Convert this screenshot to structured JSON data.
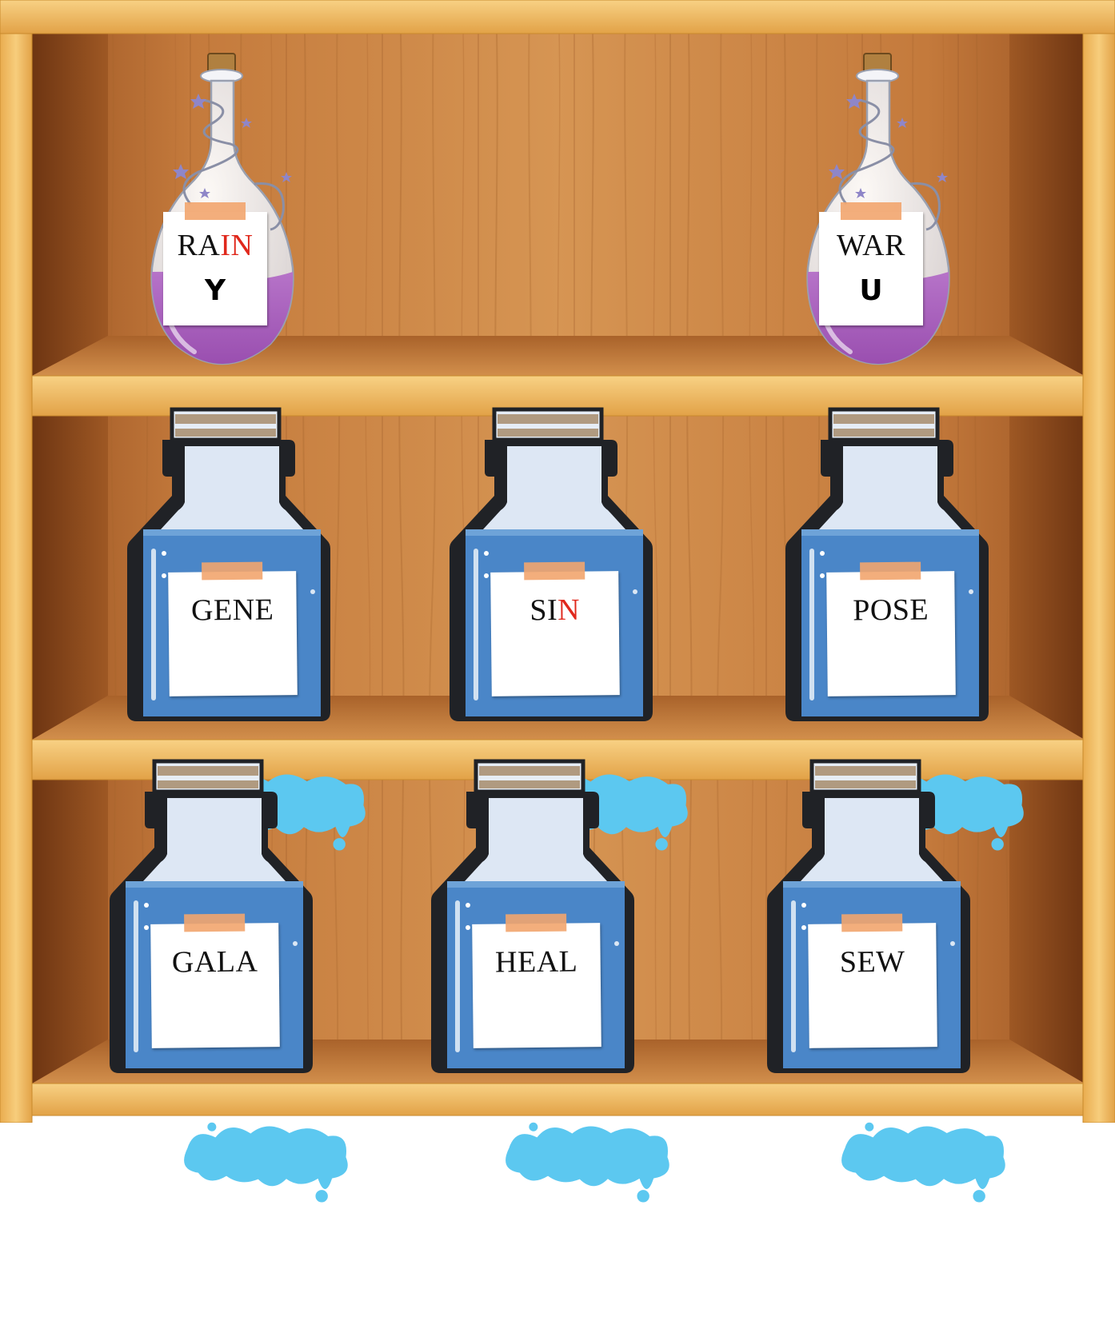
{
  "theme": {
    "frame": "#f3c06a",
    "frame_edge": "#c98a2c",
    "wood_dark": "#8a4a1f",
    "wood_mid": "#c07a3e",
    "wood_light": "#d99a5a",
    "shelf_top": "#c8843f",
    "label_tape": "#f2a56e",
    "accent_red": "#e0281c",
    "round_potion_liquid": "#9a4fb0",
    "square_potion_liquid": "#4a86c8",
    "splash": "#5cc8f0"
  },
  "shelves": [
    {
      "name": "top",
      "potions": [
        {
          "kind": "round",
          "prefix": "RA",
          "highlight": "IN",
          "suffix": "",
          "answer": "Y",
          "empty": false
        },
        {
          "kind": "round",
          "prefix": "WAR",
          "highlight": "",
          "suffix": "",
          "answer": "U",
          "empty": false
        }
      ]
    },
    {
      "name": "middle",
      "potions": [
        {
          "kind": "square",
          "prefix": "GENE",
          "highlight": "",
          "suffix": "",
          "answer": "",
          "empty": true
        },
        {
          "kind": "square",
          "prefix": "SI",
          "highlight": "N",
          "suffix": "",
          "answer": "",
          "empty": true
        },
        {
          "kind": "square",
          "prefix": "POSE",
          "highlight": "",
          "suffix": "",
          "answer": "",
          "empty": true
        }
      ]
    },
    {
      "name": "bottom",
      "potions": [
        {
          "kind": "square",
          "prefix": "GALA",
          "highlight": "",
          "suffix": "",
          "answer": "",
          "empty": true
        },
        {
          "kind": "square",
          "prefix": "HEAL",
          "highlight": "",
          "suffix": "",
          "answer": "",
          "empty": true
        },
        {
          "kind": "square",
          "prefix": "SEW",
          "highlight": "",
          "suffix": "",
          "answer": "",
          "empty": true
        }
      ]
    }
  ]
}
